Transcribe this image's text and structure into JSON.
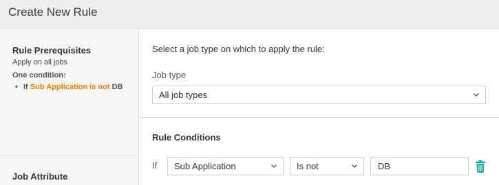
{
  "header": {
    "title": "Create New Rule"
  },
  "sidebar": {
    "prerequisites": {
      "title": "Rule Prerequisites",
      "subtitle": "Apply on all jobs",
      "condition_label": "One condition:",
      "rule_prefix": "If",
      "rule_highlight": "Sub Application is not",
      "rule_suffix": "DB"
    },
    "job_attribute_title": "Job Attribute"
  },
  "main": {
    "instruction": "Select a job type on which to apply the rule:",
    "job_type_label": "Job type",
    "job_type_value": "All job types",
    "conditions_title": "Rule Conditions",
    "condition": {
      "if_label": "If",
      "attribute": "Sub Application",
      "operator": "Is not",
      "value": "DB"
    }
  },
  "icons": {
    "chevron": "chevron-down-icon",
    "delete": "trash-icon"
  },
  "colors": {
    "highlight": "#f07d00",
    "trash": "#1aa3a3"
  }
}
